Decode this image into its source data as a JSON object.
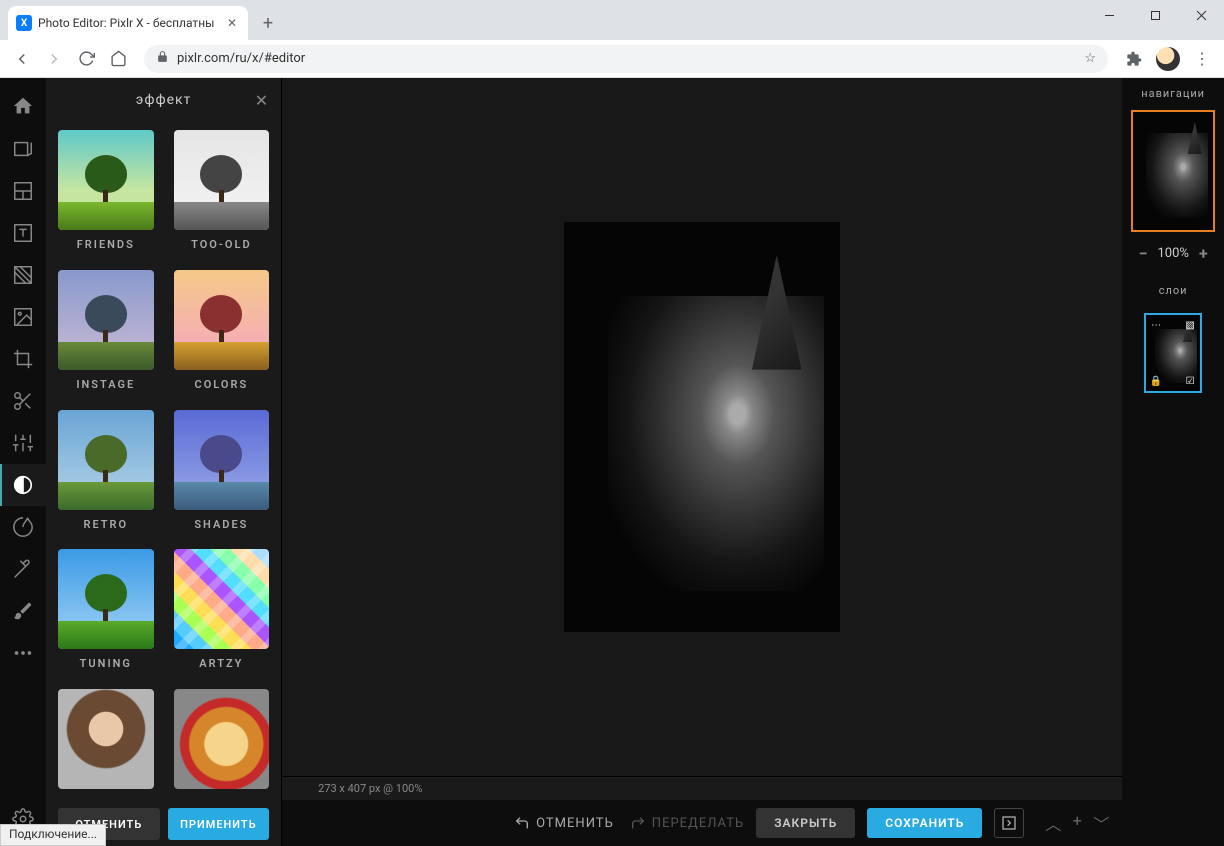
{
  "browser": {
    "tab_title": "Photo Editor: Pixlr X - бесплатны",
    "url": "pixlr.com/ru/x/#editor",
    "status_text": "Подключение..."
  },
  "panel": {
    "title": "эффект",
    "cancel": "ОТМЕНИТЬ",
    "apply": "ПРИМЕНИТЬ"
  },
  "effects": [
    {
      "label": "FRIENDS",
      "cls": "friends"
    },
    {
      "label": "TOO-OLD",
      "cls": "too-old"
    },
    {
      "label": "INSTAGE",
      "cls": "instage"
    },
    {
      "label": "COLORS",
      "cls": "colors"
    },
    {
      "label": "RETRO",
      "cls": "retro"
    },
    {
      "label": "SHADES",
      "cls": "shades"
    },
    {
      "label": "TUNING",
      "cls": "tuning"
    },
    {
      "label": "ARTZY",
      "cls": "artzy"
    },
    {
      "label": "",
      "cls": "portrait"
    },
    {
      "label": "",
      "cls": "food"
    }
  ],
  "canvas": {
    "status": "273 x 407 px @ 100%"
  },
  "history": {
    "undo": "ОТМЕНИТЬ",
    "redo": "ПЕРЕДЕЛАТЬ"
  },
  "actions": {
    "close": "ЗАКРЫТЬ",
    "save": "СОХРАНИТЬ"
  },
  "right": {
    "nav_title": "навигации",
    "zoom": "100%",
    "layers_title": "слои"
  }
}
